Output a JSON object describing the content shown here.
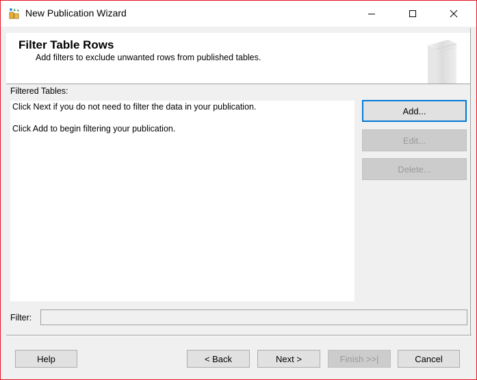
{
  "window": {
    "title": "New Publication Wizard"
  },
  "header": {
    "title": "Filter Table Rows",
    "subtitle": "Add filters to exclude unwanted rows from published tables."
  },
  "filtered_tables": {
    "label": "Filtered Tables:",
    "lines": [
      "Click Next if you do not need to filter the data in your publication.",
      "Click Add to begin filtering your publication."
    ]
  },
  "side_buttons": {
    "add": "Add...",
    "edit": "Edit...",
    "delete": "Delete..."
  },
  "filter": {
    "label": "Filter:",
    "value": ""
  },
  "footer": {
    "help": "Help",
    "back": "< Back",
    "next": "Next >",
    "finish": "Finish >>|",
    "cancel": "Cancel"
  },
  "icons": {
    "app": "wizard-app-icon",
    "header": "publication-book-icon",
    "minimize": "minimize-icon",
    "maximize": "maximize-icon",
    "close": "close-icon"
  },
  "colors": {
    "window_border": "#e81123",
    "default_button_border": "#0078d7",
    "dialog_background": "#f0f0f0"
  }
}
